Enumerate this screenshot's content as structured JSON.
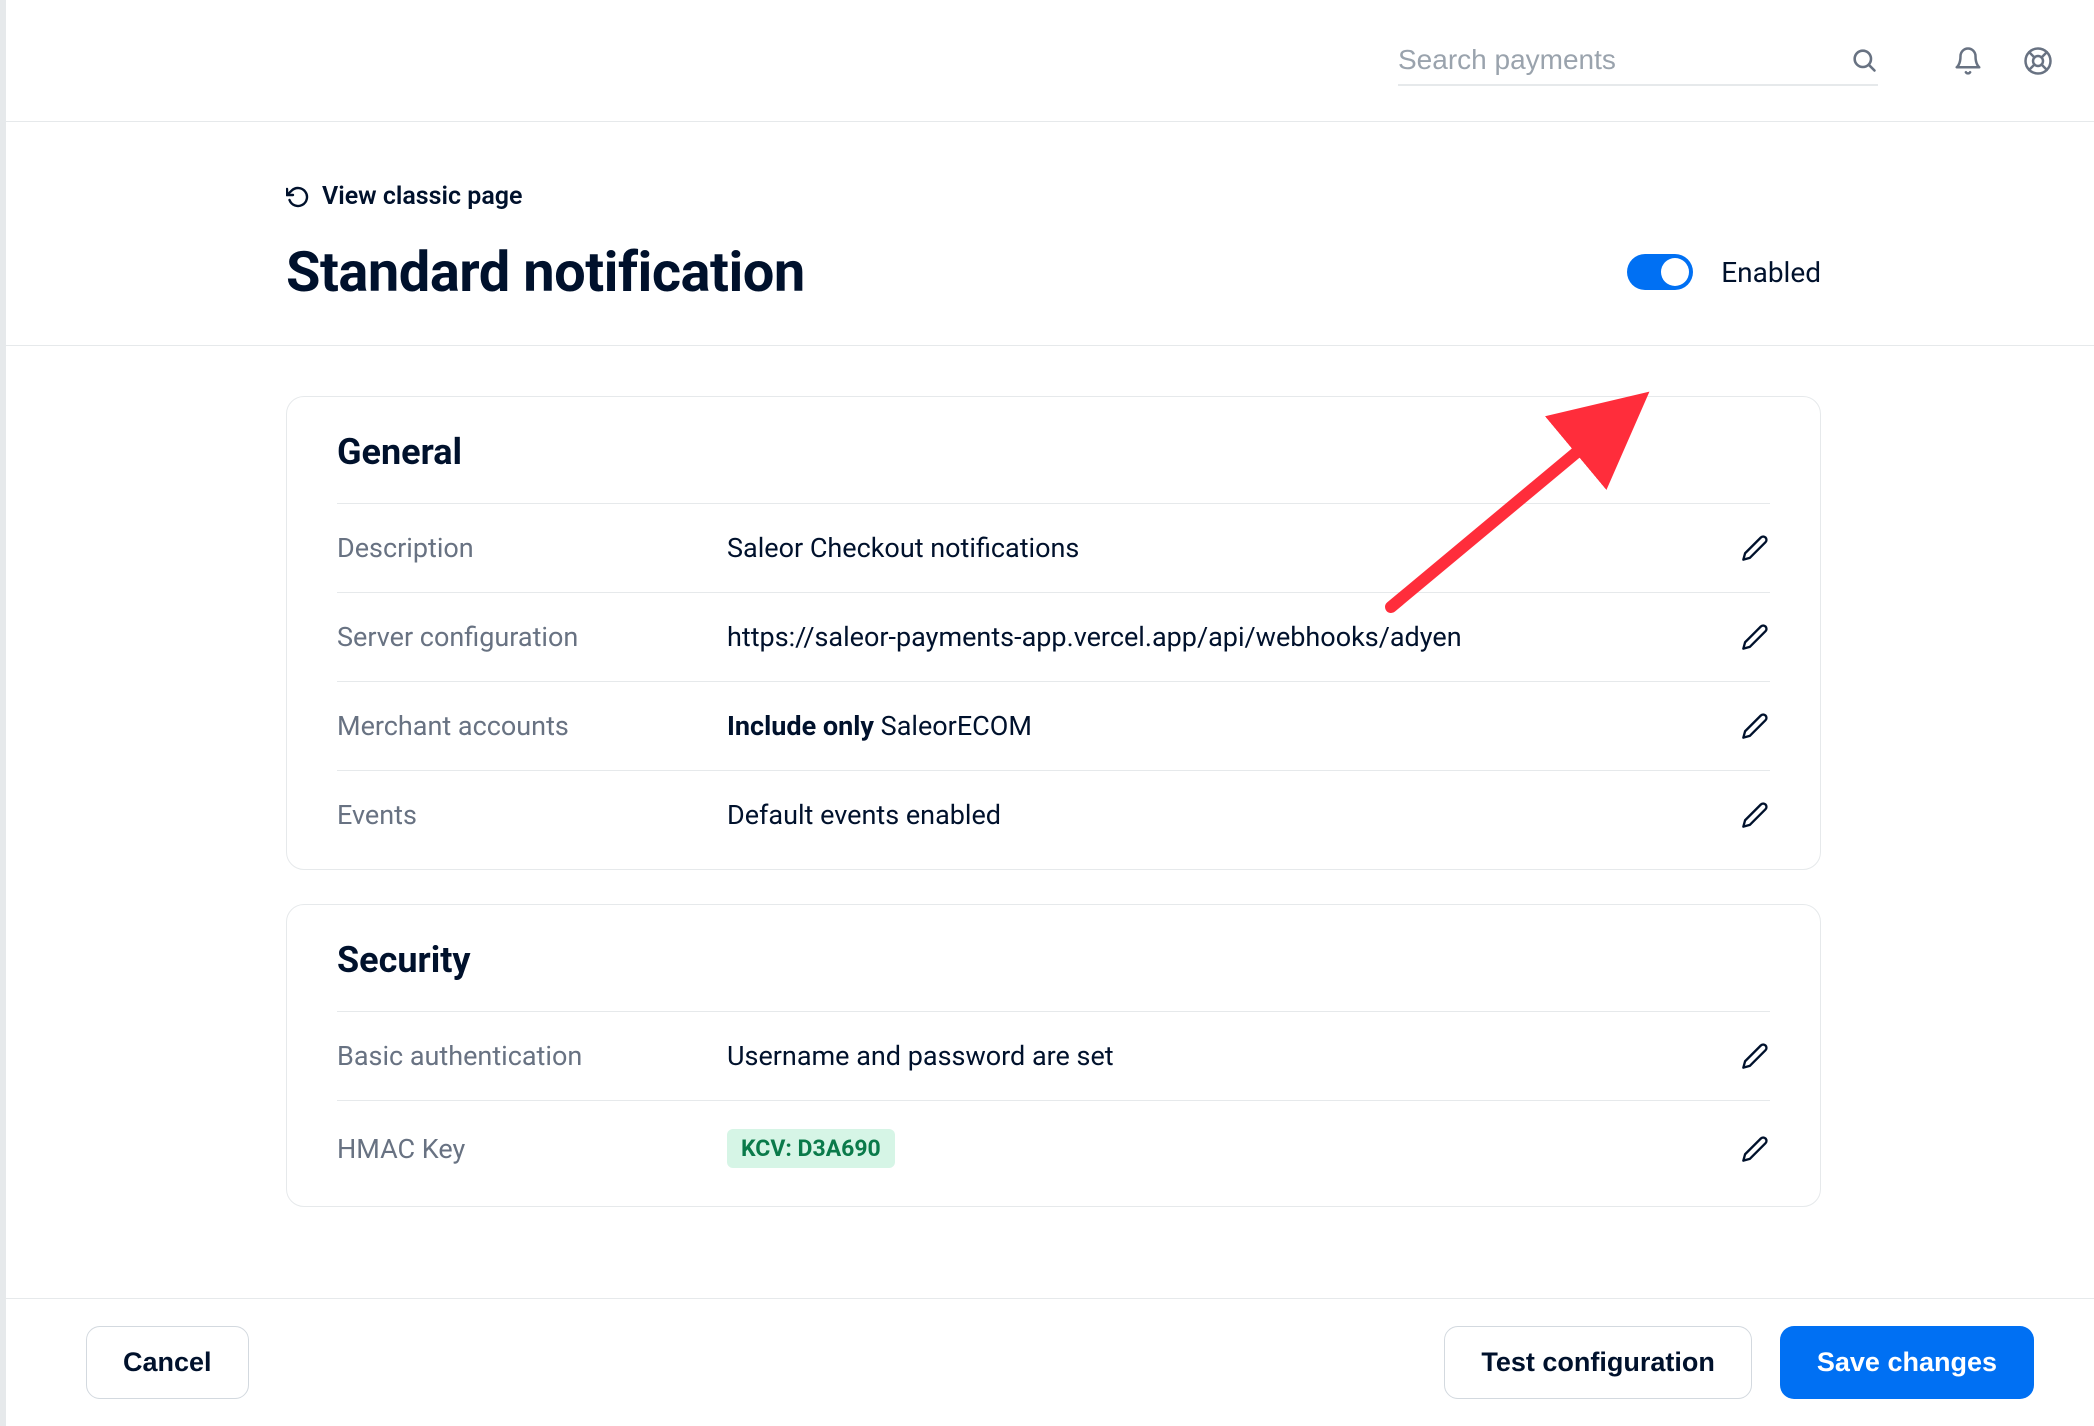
{
  "topbar": {
    "search_placeholder": "Search payments"
  },
  "header": {
    "view_classic_label": "View classic page",
    "title": "Standard notification",
    "toggle_enabled": true,
    "enabled_label": "Enabled"
  },
  "sections": {
    "general": {
      "title": "General",
      "rows": {
        "description": {
          "label": "Description",
          "value": "Saleor Checkout notifications"
        },
        "server_config": {
          "label": "Server configuration",
          "value": "https://saleor-payments-app.vercel.app/api/webhooks/adyen"
        },
        "merchant_accounts": {
          "label": "Merchant accounts",
          "value_prefix": "Include only",
          "value_suffix": " SaleorECOM"
        },
        "events": {
          "label": "Events",
          "value": "Default events enabled"
        }
      }
    },
    "security": {
      "title": "Security",
      "rows": {
        "basic_auth": {
          "label": "Basic authentication",
          "value": "Username and password are set"
        },
        "hmac_key": {
          "label": "HMAC Key",
          "badge": "KCV: D3A690"
        }
      }
    }
  },
  "footer": {
    "cancel_label": "Cancel",
    "test_label": "Test configuration",
    "save_label": "Save changes"
  }
}
